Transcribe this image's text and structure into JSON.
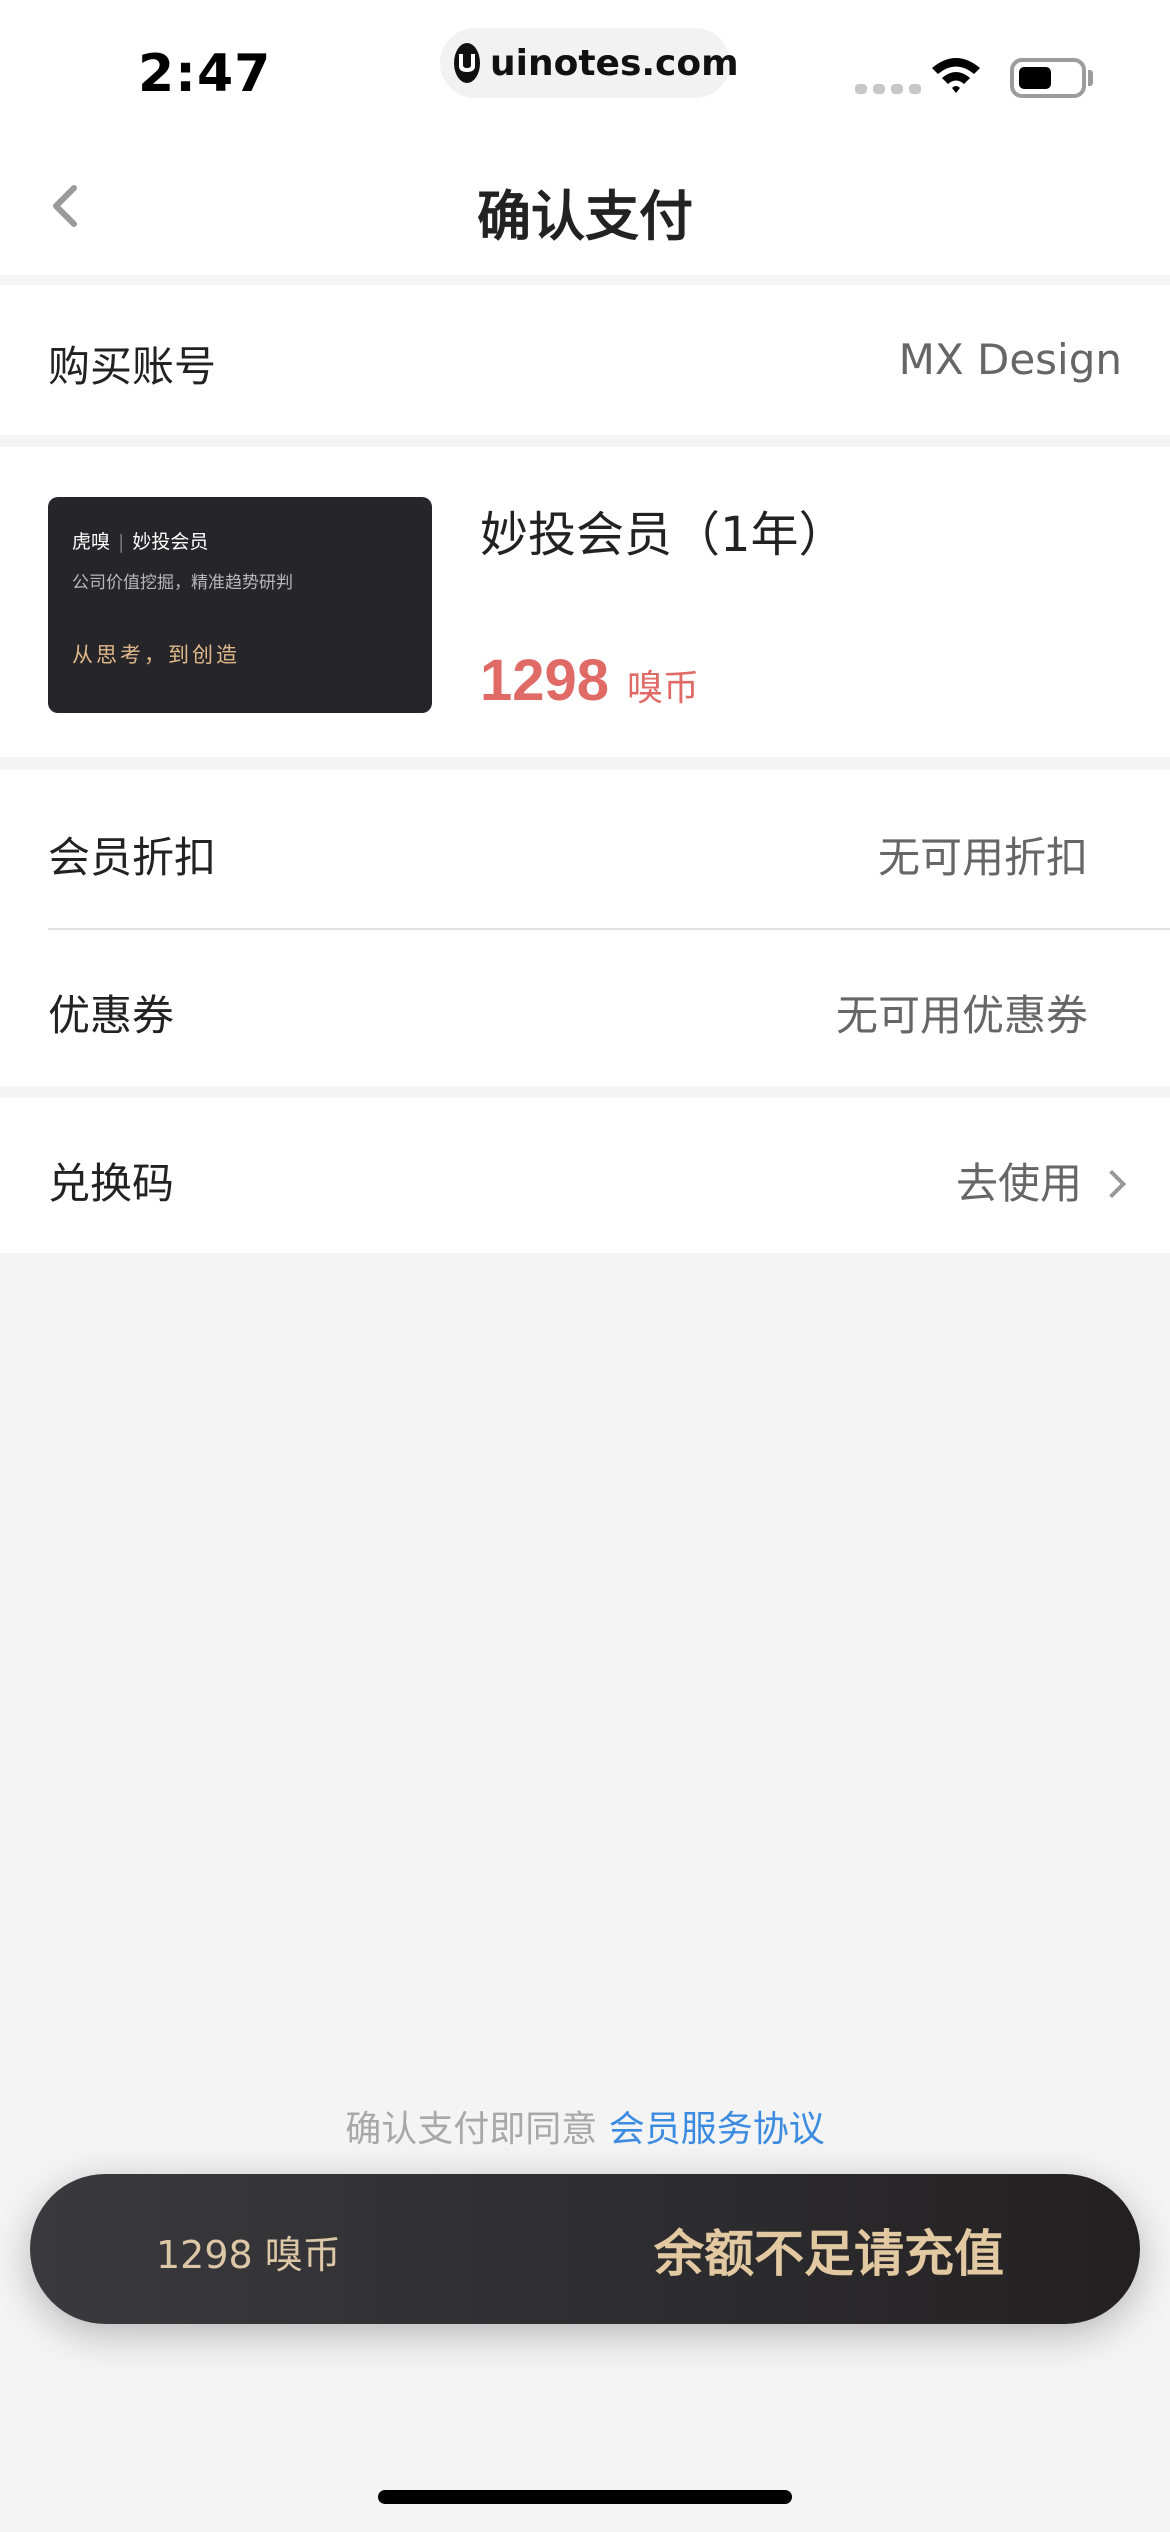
{
  "status_bar": {
    "time": "2:47",
    "url": "uinotes.com",
    "battery_level": 0.55
  },
  "nav": {
    "title": "确认支付"
  },
  "account": {
    "label": "购买账号",
    "value": "MX Design"
  },
  "product": {
    "card": {
      "brand": "虎嗅",
      "product": "妙投会员",
      "tagline": "公司价值挖掘，精准趋势研判",
      "slogan": "从思考，到创造"
    },
    "title": "妙投会员（1年）",
    "price": "1298",
    "currency": "嗅币"
  },
  "discount": {
    "label": "会员折扣",
    "value": "无可用折扣"
  },
  "coupon": {
    "label": "优惠券",
    "value": "无可用优惠券"
  },
  "redeem": {
    "label": "兑换码",
    "value": "去使用"
  },
  "agreement": {
    "prefix": "确认支付即同意",
    "link": "会员服务协议"
  },
  "pay_bar": {
    "amount": "1298 嗅币",
    "action": "余额不足请充值"
  },
  "colors": {
    "price": "#e06a66",
    "link": "#3b8be0",
    "gold": "#e3c9a2",
    "pay_bar": "#2d2d30"
  }
}
